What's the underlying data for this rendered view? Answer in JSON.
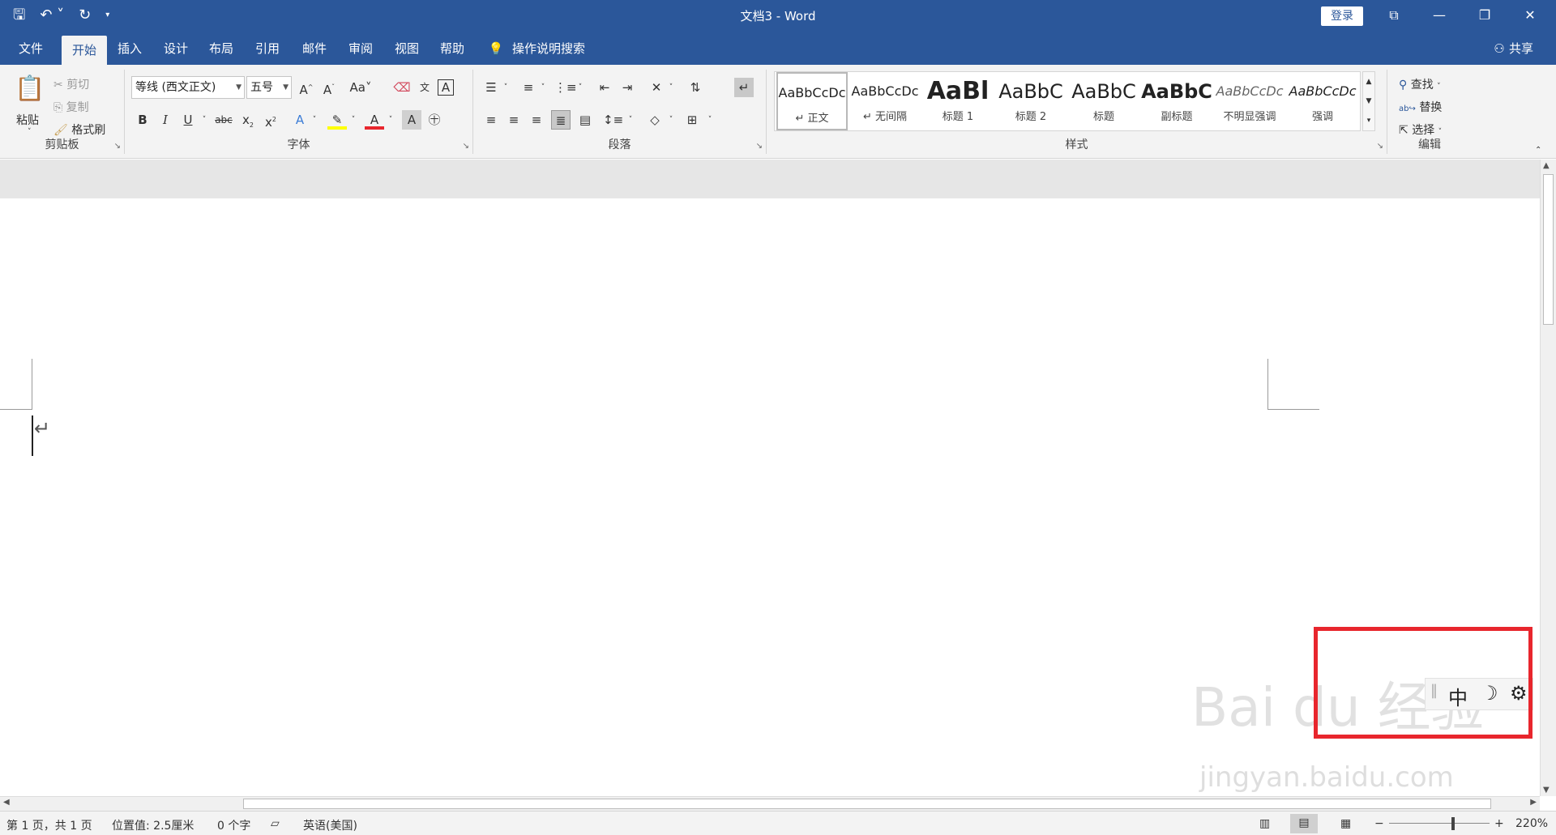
{
  "titlebar": {
    "doc_title": "文档3 - Word",
    "login": "登录",
    "qat": [
      "save-icon",
      "undo-icon",
      "redo-icon",
      "customize-icon"
    ]
  },
  "menu": {
    "tabs": [
      "文件",
      "开始",
      "插入",
      "设计",
      "布局",
      "引用",
      "邮件",
      "审阅",
      "视图",
      "帮助"
    ],
    "search": "操作说明搜索",
    "share": "共享"
  },
  "ribbon": {
    "clipboard": {
      "label": "剪贴板",
      "paste": "粘贴",
      "cut": "剪切",
      "copy": "复制",
      "format_painter": "格式刷"
    },
    "font": {
      "label": "字体",
      "font_name": "等线 (西文正文)",
      "font_size": "五号"
    },
    "paragraph": {
      "label": "段落"
    },
    "styles": {
      "label": "样式",
      "items": [
        {
          "preview": "AaBbCcDc",
          "name": "↵ 正文"
        },
        {
          "preview": "AaBbCcDc",
          "name": "↵ 无间隔"
        },
        {
          "preview": "AaBl",
          "name": "标题 1"
        },
        {
          "preview": "AaBbC",
          "name": "标题 2"
        },
        {
          "preview": "AaBbC",
          "name": "标题"
        },
        {
          "preview": "AaBbC",
          "name": "副标题"
        },
        {
          "preview": "AaBbCcDc",
          "name": "不明显强调"
        },
        {
          "preview": "AaBbCcDc",
          "name": "强调"
        }
      ]
    },
    "editing": {
      "label": "编辑",
      "find": "查找",
      "replace": "替换",
      "select": "选择"
    }
  },
  "ime": {
    "mode": "中"
  },
  "watermark": {
    "brand": "Bai du 经验",
    "url": "jingyan.baidu.com"
  },
  "status": {
    "page": "第 1 页，共 1 页",
    "position": "位置值: 2.5厘米",
    "words": "0 个字",
    "language": "英语(美国)",
    "zoom": "220%"
  }
}
